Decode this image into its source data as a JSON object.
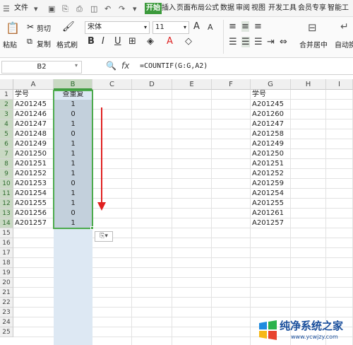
{
  "ribbon_tabs": {
    "file": "文件",
    "start": "开始",
    "insert": "插入",
    "page_layout": "页面布局",
    "formula": "公式",
    "data": "数据",
    "review": "审阅",
    "view": "视图",
    "developer": "开发工具",
    "vip": "会员专享",
    "smart": "智能工"
  },
  "ribbon": {
    "paste": "粘贴",
    "cut": "剪切",
    "copy": "复制",
    "format_painter": "格式刷",
    "font_name": "宋体",
    "font_size": "11",
    "merge_center": "合并居中",
    "auto_wrap": "自动换",
    "bold": "B",
    "italic": "I",
    "underline": "U",
    "font_grow": "A",
    "font_shrink": "A"
  },
  "formula_bar": {
    "name_box": "B2",
    "fx": "fx",
    "formula": "=COUNTIF(G:G,A2)"
  },
  "columns": [
    "A",
    "B",
    "C",
    "D",
    "E",
    "F",
    "G",
    "H",
    "I"
  ],
  "rows": [
    "1",
    "2",
    "3",
    "4",
    "5",
    "6",
    "7",
    "8",
    "9",
    "10",
    "11",
    "12",
    "13",
    "14",
    "15",
    "16",
    "17",
    "18",
    "19",
    "20",
    "21",
    "22",
    "23",
    "24",
    "25"
  ],
  "col_a": [
    "学号",
    "A201245",
    "A201246",
    "A201247",
    "A201248",
    "A201249",
    "A201250",
    "A201251",
    "A201252",
    "A201253",
    "A201254",
    "A201255",
    "A201256",
    "A201257"
  ],
  "col_b": [
    "查重复",
    "1",
    "0",
    "1",
    "0",
    "1",
    "1",
    "1",
    "1",
    "0",
    "1",
    "1",
    "0",
    "1"
  ],
  "col_g": [
    "学号",
    "A201245",
    "A201260",
    "A201247",
    "A201258",
    "A201249",
    "A201250",
    "A201251",
    "A201252",
    "A201259",
    "A201254",
    "A201255",
    "A201261",
    "A201257"
  ],
  "paste_options_icon": "paste-options-icon",
  "watermark": {
    "name": "纯净系统之家",
    "url": "www.ycwjzy.com"
  },
  "colors": {
    "accent": "#3c9a3c",
    "arrow": "#e02020",
    "selection": "#c3d0dc"
  }
}
